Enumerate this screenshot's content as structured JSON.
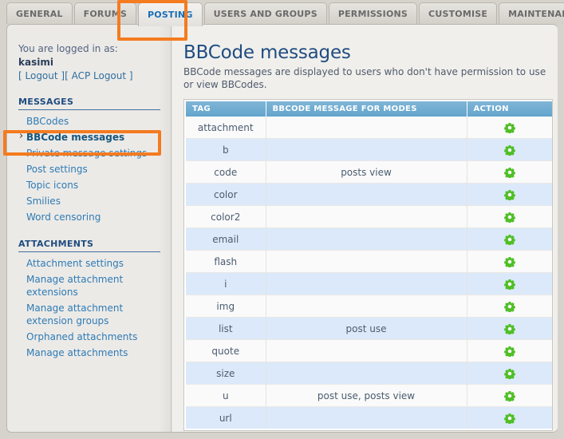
{
  "tabs": [
    {
      "label": "GENERAL",
      "active": false
    },
    {
      "label": "FORUMS",
      "active": false
    },
    {
      "label": "POSTING",
      "active": true
    },
    {
      "label": "USERS AND GROUPS",
      "active": false
    },
    {
      "label": "PERMISSIONS",
      "active": false
    },
    {
      "label": "CUSTOMISE",
      "active": false
    },
    {
      "label": "MAINTENANCE",
      "active": false
    }
  ],
  "menu_tab": {
    "icon": "hamburger-icon"
  },
  "sidebar": {
    "logged_in_label": "You are logged in as:",
    "username": "kasimi",
    "logout_open": "[ Logout ]",
    "acp_logout": "[ ACP Logout ]",
    "sections": [
      {
        "title": "MESSAGES",
        "items": [
          {
            "label": "BBCodes",
            "current": false
          },
          {
            "label": "BBCode messages",
            "current": true
          },
          {
            "label": "Private message settings",
            "current": false
          },
          {
            "label": "Post settings",
            "current": false
          },
          {
            "label": "Topic icons",
            "current": false
          },
          {
            "label": "Smilies",
            "current": false
          },
          {
            "label": "Word censoring",
            "current": false
          }
        ]
      },
      {
        "title": "ATTACHMENTS",
        "items": [
          {
            "label": "Attachment settings",
            "current": false
          },
          {
            "label": "Manage attachment extensions",
            "current": false
          },
          {
            "label": "Manage attachment extension groups",
            "current": false
          },
          {
            "label": "Orphaned attachments",
            "current": false
          },
          {
            "label": "Manage attachments",
            "current": false
          }
        ]
      }
    ]
  },
  "content": {
    "title": "BBCode messages",
    "description": "BBCode messages are displayed to users who don't have permission to use or view BBCodes.",
    "table": {
      "headers": [
        "TAG",
        "BBCODE MESSAGE FOR MODES",
        "ACTION"
      ],
      "rows": [
        {
          "tag": "attachment",
          "modes": ""
        },
        {
          "tag": "b",
          "modes": ""
        },
        {
          "tag": "code",
          "modes": "posts view"
        },
        {
          "tag": "color",
          "modes": ""
        },
        {
          "tag": "color2",
          "modes": ""
        },
        {
          "tag": "email",
          "modes": ""
        },
        {
          "tag": "flash",
          "modes": ""
        },
        {
          "tag": "i",
          "modes": ""
        },
        {
          "tag": "img",
          "modes": ""
        },
        {
          "tag": "list",
          "modes": "post use"
        },
        {
          "tag": "quote",
          "modes": ""
        },
        {
          "tag": "size",
          "modes": ""
        },
        {
          "tag": "u",
          "modes": "post use, posts view"
        },
        {
          "tag": "url",
          "modes": ""
        }
      ],
      "action_icon": "gear-icon"
    }
  },
  "annotations": [
    {
      "name": "posting-tab-highlight",
      "color": "#f47b20"
    },
    {
      "name": "bbcode-messages-nav-highlight",
      "color": "#f47b20"
    }
  ]
}
